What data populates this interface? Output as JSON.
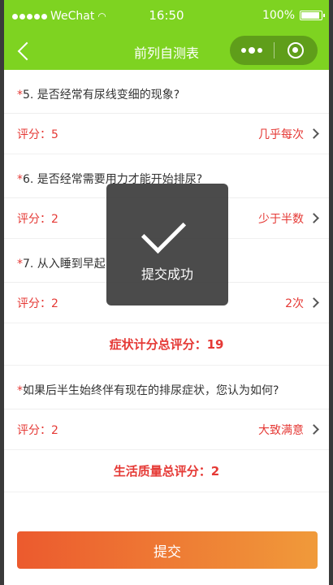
{
  "status_bar": {
    "carrier": "WeChat",
    "time": "16:50",
    "battery": "100%"
  },
  "nav": {
    "title": "前列自测表"
  },
  "items": [
    {
      "star": "*",
      "question": "5. 是否经常有尿线变细的现象?",
      "score_label": "评分：5",
      "answer": "几乎每次"
    },
    {
      "star": "*",
      "question": "6. 是否经常需要用力才能开始排尿?",
      "score_label": "评分：2",
      "answer": "少于半数"
    },
    {
      "star": "*",
      "question": "7. 从入睡到早起",
      "score_label": "评分：2",
      "answer": "2次"
    }
  ],
  "symptom_total": "症状计分总评分：19",
  "quality_item": {
    "star": "*",
    "question": "如果后半生始终伴有现在的排尿症状，您认为如何?",
    "score_label": "评分：2",
    "answer": "大致满意"
  },
  "quality_total": "生活质量总评分：2",
  "submit_label": "提交",
  "toast": {
    "text": "提交成功"
  },
  "colors": {
    "header": "#7ed321",
    "accent_red": "#e53935",
    "button_gradient_start": "#ec5a2e",
    "button_gradient_end": "#f09a3a"
  }
}
